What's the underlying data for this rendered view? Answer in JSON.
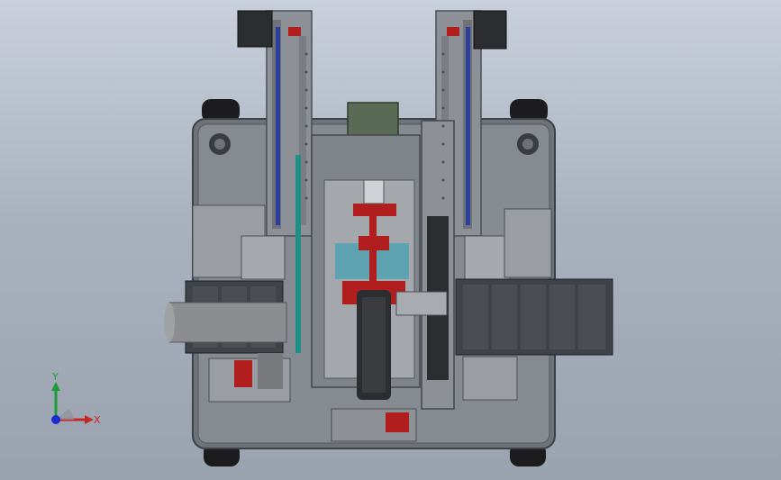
{
  "viewport": {
    "background_top": "#c9d0dc",
    "background_bottom": "#9aa2b0",
    "model_colors": {
      "frame": "#7b7f86",
      "frame_dark": "#4a4e55",
      "plate": "#8e9299",
      "motor": "#2b2d30",
      "rod_blue": "#2c3f9c",
      "accent_red": "#b01e1e",
      "accent_teal": "#1f8f86",
      "copper": "#a86a3a",
      "olive": "#5a6b55",
      "roller": "#8b8d91"
    }
  },
  "triad": {
    "y_label": "Y",
    "x_label": "X",
    "y_color": "#1e9a3a",
    "x_color": "#c62828",
    "z_color": "#1a2cd1"
  }
}
